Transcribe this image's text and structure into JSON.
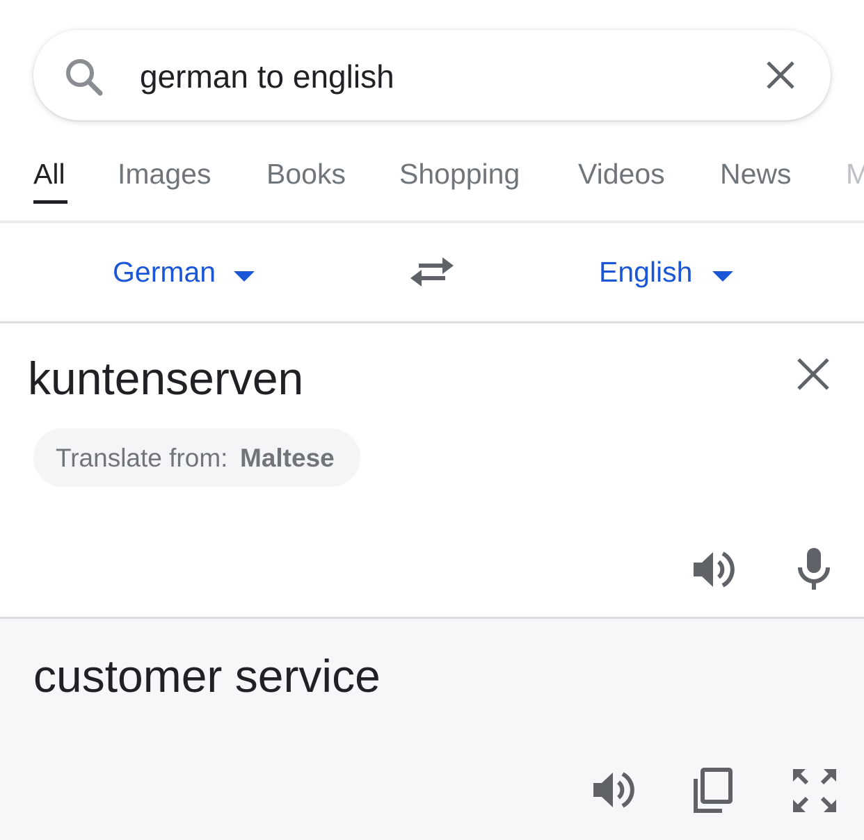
{
  "search": {
    "query": "german to english"
  },
  "tabs": [
    {
      "label": "All",
      "active": true
    },
    {
      "label": "Images",
      "active": false
    },
    {
      "label": "Books",
      "active": false
    },
    {
      "label": "Shopping",
      "active": false
    },
    {
      "label": "Videos",
      "active": false
    },
    {
      "label": "News",
      "active": false
    },
    {
      "label": "M",
      "active": false
    }
  ],
  "translator": {
    "source_language": "German",
    "target_language": "English",
    "source_text": "kuntenserven",
    "detected": {
      "label": "Translate from:",
      "language": "Maltese"
    },
    "target_text": "customer service"
  },
  "icons": {
    "search": "search-icon",
    "clear": "close-icon",
    "swap": "swap-arrows-icon",
    "dropdown": "caret-down-icon",
    "speaker": "speaker-icon",
    "mic": "microphone-icon",
    "copy": "copy-icon",
    "fullscreen": "fullscreen-icon"
  },
  "colors": {
    "accent": "#1a56d6",
    "text": "#202124",
    "muted": "#70757a",
    "icon": "#5f6368",
    "panel": "#f6f7f9"
  }
}
